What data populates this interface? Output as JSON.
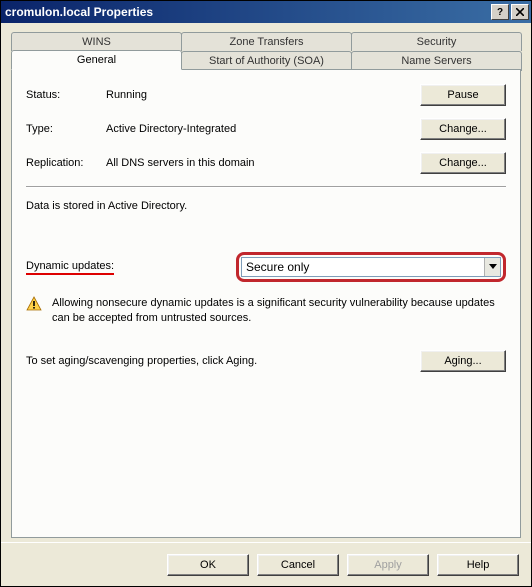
{
  "title": "cromulon.local Properties",
  "tabs_back": [
    "WINS",
    "Zone Transfers",
    "Security"
  ],
  "tabs_front": [
    "General",
    "Start of Authority (SOA)",
    "Name Servers"
  ],
  "active_tab": "General",
  "fields": {
    "status_label": "Status:",
    "status_value": "Running",
    "type_label": "Type:",
    "type_value": "Active Directory-Integrated",
    "replication_label": "Replication:",
    "replication_value": "All DNS servers in this domain"
  },
  "buttons": {
    "pause": "Pause",
    "change1": "Change...",
    "change2": "Change...",
    "aging": "Aging..."
  },
  "storage_text": "Data is stored in Active Directory.",
  "dynamic_updates_label": "Dynamic updates:",
  "dynamic_updates_value": "Secure only",
  "warning_text": "Allowing nonsecure dynamic updates is a significant security vulnerability because updates can be accepted from untrusted sources.",
  "aging_text": "To set aging/scavenging properties, click Aging.",
  "footer": {
    "ok": "OK",
    "cancel": "Cancel",
    "apply": "Apply",
    "help": "Help"
  }
}
